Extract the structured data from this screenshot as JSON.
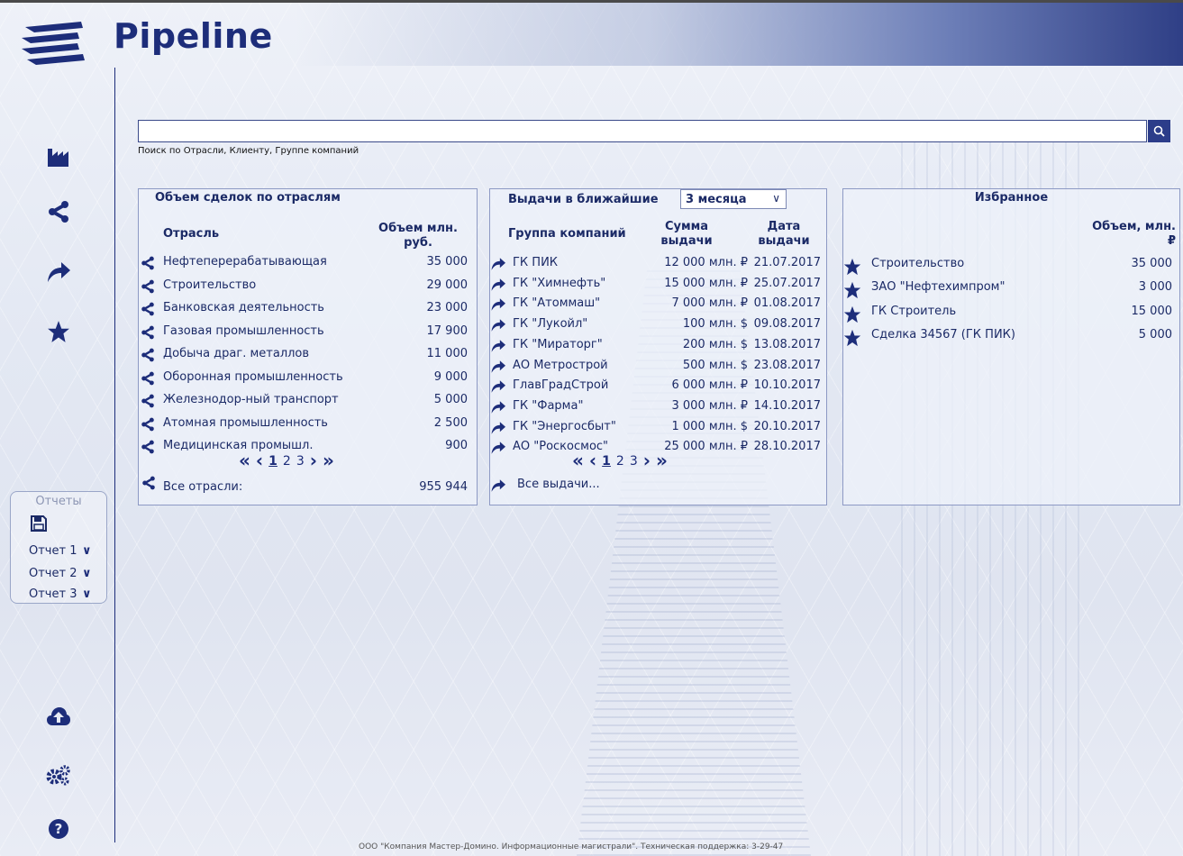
{
  "app": {
    "title": "Pipeline"
  },
  "nav": [
    {
      "icon": "factory-icon"
    },
    {
      "icon": "share-icon"
    },
    {
      "icon": "forward-arrow-icon"
    },
    {
      "icon": "star-icon"
    },
    {
      "icon": "cloud-upload-icon"
    },
    {
      "icon": "settings-icon"
    },
    {
      "icon": "help-icon"
    }
  ],
  "reports": {
    "title": "Отчеты",
    "items": [
      {
        "label": "Отчет 1"
      },
      {
        "label": "Отчет 2"
      },
      {
        "label": "Отчет 3"
      }
    ]
  },
  "search": {
    "value": "",
    "placeholder": "",
    "hint": "Поиск по Отрасли, Клиенту, Группе компаний"
  },
  "industries": {
    "title": "Объем сделок по отраслям",
    "col_name": "Отрасль",
    "col_volume": "Объем млн. руб.",
    "rows": [
      {
        "name": "Нефтеперерабатывающая",
        "value": "35 000"
      },
      {
        "name": "Строительство",
        "value": "29 000"
      },
      {
        "name": "Банковская деятельность",
        "value": "23 000"
      },
      {
        "name": "Газовая промышленность",
        "value": "17 900"
      },
      {
        "name": "Добыча драг. металлов",
        "value": "11 000"
      },
      {
        "name": "Оборонная промышленность",
        "value": "9 000"
      },
      {
        "name": "Железнодор-ный транспорт",
        "value": "5 000"
      },
      {
        "name": "Атомная промышленность",
        "value": "2 500"
      },
      {
        "name": "Медицинская промышл.",
        "value": "900"
      }
    ],
    "pager": {
      "pages": [
        "1",
        "2",
        "3"
      ],
      "current": "1"
    },
    "total_label": "Все отрасли:",
    "total_value": "955 944"
  },
  "issuances": {
    "title": "Выдачи в ближайшие",
    "period": "3 месяца",
    "col_group": "Группа компаний",
    "col_amount": "Сумма выдачи",
    "col_date": "Дата выдачи",
    "rows": [
      {
        "name": "ГК ПИК",
        "amount": "12 000 млн. ₽",
        "date": "21.07.2017"
      },
      {
        "name": "ГК \"Химнефть\"",
        "amount": "15 000 млн. ₽",
        "date": "25.07.2017"
      },
      {
        "name": "ГК \"Атоммаш\"",
        "amount": "7 000 млн. ₽",
        "date": "01.08.2017"
      },
      {
        "name": "ГК \"Лукойл\"",
        "amount": "100 млн. $",
        "date": "09.08.2017"
      },
      {
        "name": "ГК \"Мираторг\"",
        "amount": "200 млн. $",
        "date": "13.08.2017"
      },
      {
        "name": "АО Метрострой",
        "amount": "500 млн. $",
        "date": "23.08.2017"
      },
      {
        "name": "ГлавГрадСтрой",
        "amount": "6 000 млн. ₽",
        "date": "10.10.2017"
      },
      {
        "name": "ГК \"Фарма\"",
        "amount": "3 000 млн. ₽",
        "date": "14.10.2017"
      },
      {
        "name": "ГК \"Энергосбыт\"",
        "amount": "1 000 млн. $",
        "date": "20.10.2017"
      },
      {
        "name": "АО \"Роскосмос\"",
        "amount": "25 000 млн. ₽",
        "date": "28.10.2017"
      }
    ],
    "pager": {
      "pages": [
        "1",
        "2",
        "3"
      ],
      "current": "1"
    },
    "all_label": "Все выдачи..."
  },
  "favorites": {
    "title": "Избранное",
    "col_volume": "Объем, млн. ₽",
    "rows": [
      {
        "name": "Строительство",
        "value": "35 000"
      },
      {
        "name": "ЗАО \"Нефтехимпром\"",
        "value": "3 000"
      },
      {
        "name": "ГК Строитель",
        "value": "15 000"
      },
      {
        "name": "Сделка 34567 (ГК ПИК)",
        "value": "5 000"
      }
    ]
  },
  "footer": {
    "text": "ООО \"Компания Мастер-Домино. Информационные магистрали\". Техническая поддержка: 3-29-47"
  },
  "colors": {
    "accent": "#1d2d7a",
    "search_button": "#2c3d8a"
  }
}
